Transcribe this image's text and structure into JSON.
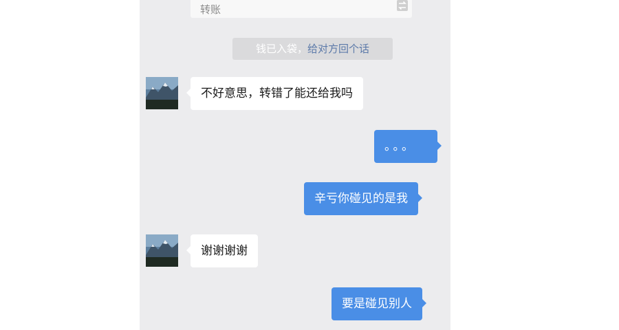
{
  "transfer_card": {
    "label": "转账",
    "icon": "transfer-icon"
  },
  "system_notice": {
    "text": "钱已入袋，",
    "link": "给对方回个话"
  },
  "messages": [
    {
      "sender": "other",
      "text": "不好意思，转错了能还给我吗"
    },
    {
      "sender": "me",
      "text": "。。。"
    },
    {
      "sender": "me",
      "text": "辛亏你碰见的是我"
    },
    {
      "sender": "other",
      "text": "谢谢谢谢"
    },
    {
      "sender": "me",
      "text": "要是碰见别人"
    }
  ],
  "colors": {
    "chat_background": "#ececee",
    "outgoing_bubble": "#4a8ee6",
    "incoming_bubble": "#ffffff",
    "link": "#5b79a9"
  }
}
